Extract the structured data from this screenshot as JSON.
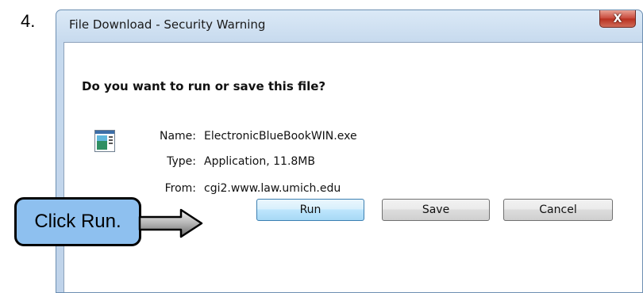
{
  "step_number": "4.",
  "window": {
    "title": "File Download - Security Warning",
    "close_label": "X"
  },
  "dialog": {
    "question": "Do you want to run or save this file?",
    "file_icon": "application-file-icon",
    "fields": [
      {
        "label": "Name:",
        "value": "ElectronicBlueBookWIN.exe"
      },
      {
        "label": "Type:",
        "value": "Application, 11.8MB"
      },
      {
        "label": "From:",
        "value": "cgi2.www.law.umich.edu"
      }
    ]
  },
  "buttons": {
    "run": "Run",
    "save": "Save",
    "cancel": "Cancel"
  },
  "annotation": {
    "callout_text": "Click Run.",
    "arrow_icon": "right-arrow-icon"
  }
}
